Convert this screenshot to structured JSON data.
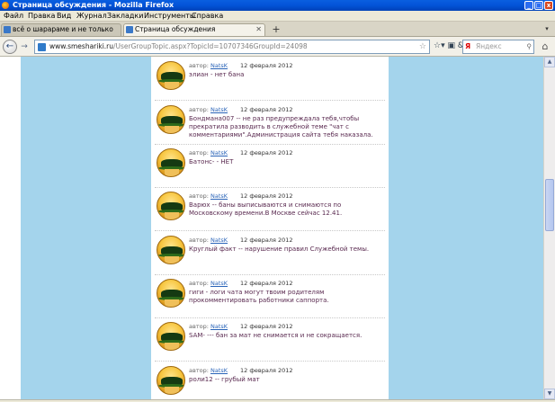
{
  "window": {
    "title": "Страница обсуждения - Mozilla Firefox",
    "buttons": {
      "minimize": "_",
      "maximize": "□",
      "close": "x"
    }
  },
  "menu": [
    "Файл",
    "Правка",
    "Вид",
    "Журнал",
    "Закладки",
    "Инструменты",
    "Справка"
  ],
  "tabs": [
    {
      "label": "всё о шарараме и не только",
      "active": false
    },
    {
      "label": "Страница обсуждения",
      "active": true
    }
  ],
  "tab_new_label": "+",
  "nav": {
    "url_host": "www.smeshariki.ru",
    "url_path": "/UserGroupTopic.aspx?TopicId=10707346GroupId=24098",
    "tools": "☆▾ ▣ & ▾",
    "search_placeholder": "Яндекс",
    "search_engine_glyph": "Я"
  },
  "author_label": "автор:",
  "posts": [
    {
      "author": "NatsK",
      "date": "12 февраля 2012",
      "text": "элиан - нет бана"
    },
    {
      "author": "NatsK",
      "date": "12 февраля 2012",
      "text": "Бондмана007 -- не раз предупреждала тебя,чтобы прекратила разводить в служебной теме \"чат с комментариями\".Администрация сайта тебя наказала."
    },
    {
      "author": "NatsK",
      "date": "12 февраля 2012",
      "text": "Батонс- - НЕТ"
    },
    {
      "author": "NatsK",
      "date": "12 февраля 2012",
      "text": "Варюх -- баны выписываются и снимаются по Московскому времени.В Москве сейчас 12.41."
    },
    {
      "author": "NatsK",
      "date": "12 февраля 2012",
      "text": "Круглый факт -- нарушение правил Служебной темы."
    },
    {
      "author": "NatsK",
      "date": "12 февраля 2012",
      "text": "гиги - логи чата могут твоим родителям прокомментировать работники саппорта."
    },
    {
      "author": "NatsK",
      "date": "12 февраля 2012",
      "text": "SAM- --- бан за мат не снимается и не сокращается."
    },
    {
      "author": "NatsK",
      "date": "12 февраля 2012",
      "text": "роли12 -- грубый мат"
    }
  ]
}
